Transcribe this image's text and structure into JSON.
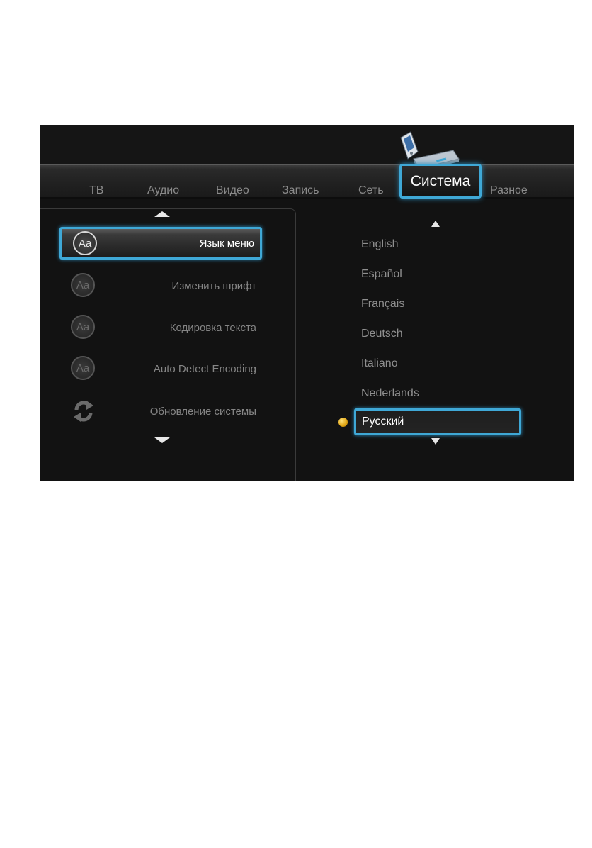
{
  "tabs": [
    "ТВ",
    "Аудио",
    "Видео",
    "Запись",
    "Сеть"
  ],
  "active_tab": "Система",
  "extra_tab": "Разное",
  "menu": {
    "items": [
      {
        "label": "Язык меню",
        "icon": "aa-icon",
        "selected": true
      },
      {
        "label": "Изменить шрифт",
        "icon": "aa-icon",
        "selected": false
      },
      {
        "label": "Кодировка текста",
        "icon": "aa-icon",
        "selected": false
      },
      {
        "label": "Auto Detect Encoding",
        "icon": "aa-icon",
        "selected": false
      },
      {
        "label": "Обновление системы",
        "icon": "refresh-icon",
        "selected": false
      }
    ]
  },
  "languages": {
    "items": [
      "English",
      "Español",
      "Français",
      "Deutsch",
      "Italiano",
      "Nederlands"
    ],
    "selected": "Русский"
  },
  "colors": {
    "accent": "#3fa8d6",
    "background": "#121212",
    "current_indicator": "#e0a412"
  }
}
